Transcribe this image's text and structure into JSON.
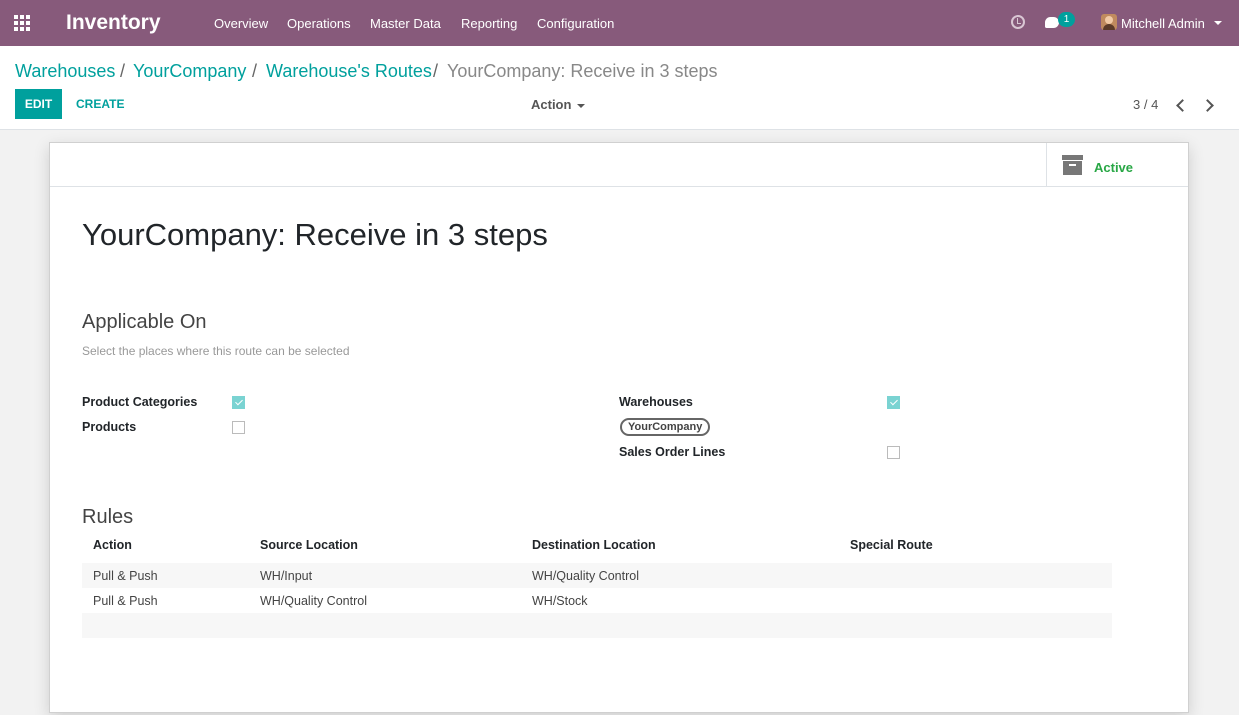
{
  "navbar": {
    "app_name": "Inventory",
    "menus": [
      "Overview",
      "Operations",
      "Master Data",
      "Reporting",
      "Configuration"
    ],
    "message_count": "1",
    "user_name": "Mitchell Admin",
    "brand_color": "#875a7b"
  },
  "breadcrumb": {
    "items": [
      "Warehouses",
      "YourCompany",
      "Warehouse's Routes"
    ],
    "separator": "/",
    "current": "YourCompany: Receive in 3 steps"
  },
  "toolbar": {
    "edit_label": "EDIT",
    "create_label": "CREATE",
    "action_label": "Action",
    "pager": "3 / 4"
  },
  "record": {
    "active_label": "Active",
    "title": "YourCompany: Receive in 3 steps",
    "applicable_on": {
      "heading": "Applicable On",
      "helper": "Select the places where this route can be selected",
      "product_categories_label": "Product Categories",
      "product_categories_checked": true,
      "products_label": "Products",
      "products_checked": false,
      "warehouses_label": "Warehouses",
      "warehouses_checked": true,
      "warehouse_tag": "YourCompany",
      "sales_order_lines_label": "Sales Order Lines",
      "sales_order_lines_checked": false
    },
    "rules": {
      "heading": "Rules",
      "columns": [
        "Action",
        "Source Location",
        "Destination Location",
        "Special Route"
      ],
      "rows": [
        [
          "Pull & Push",
          "WH/Input",
          "WH/Quality Control",
          ""
        ],
        [
          "Pull & Push",
          "WH/Quality Control",
          "WH/Stock",
          ""
        ]
      ]
    }
  },
  "colors": {
    "accent": "#00a09d",
    "active_green": "#28a745",
    "checkbox_checked": "#7ad3d2"
  }
}
